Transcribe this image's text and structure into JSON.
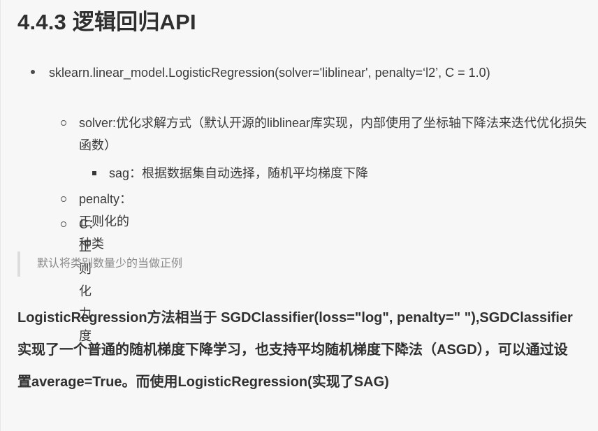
{
  "heading": "4.4.3 逻辑回归API",
  "api": {
    "signature": "sklearn.linear_model.LogisticRegression(solver='liblinear', penalty=‘l2’, C = 1.0)",
    "params": [
      {
        "text": "solver:优化求解方式（默认开源的liblinear库实现，内部使用了坐标轴下降法来迭代优化损失函数）"
      },
      {
        "text": "penalty：正则化的种类"
      },
      {
        "text": "C：正则化力度"
      }
    ],
    "solver_options": [
      {
        "text": "sag：根据数据集自动选择，随机平均梯度下降"
      }
    ]
  },
  "note": "默认将类别数量少的当做正例",
  "explanation": "LogisticRegression方法相当于 SGDClassifier(loss=\"log\", penalty=\" \"),SGDClassifier实现了一个普通的随机梯度下降学习，也支持平均随机梯度下降法（ASGD），可以通过设置average=True。而使用LogisticRegression(实现了SAG)"
}
